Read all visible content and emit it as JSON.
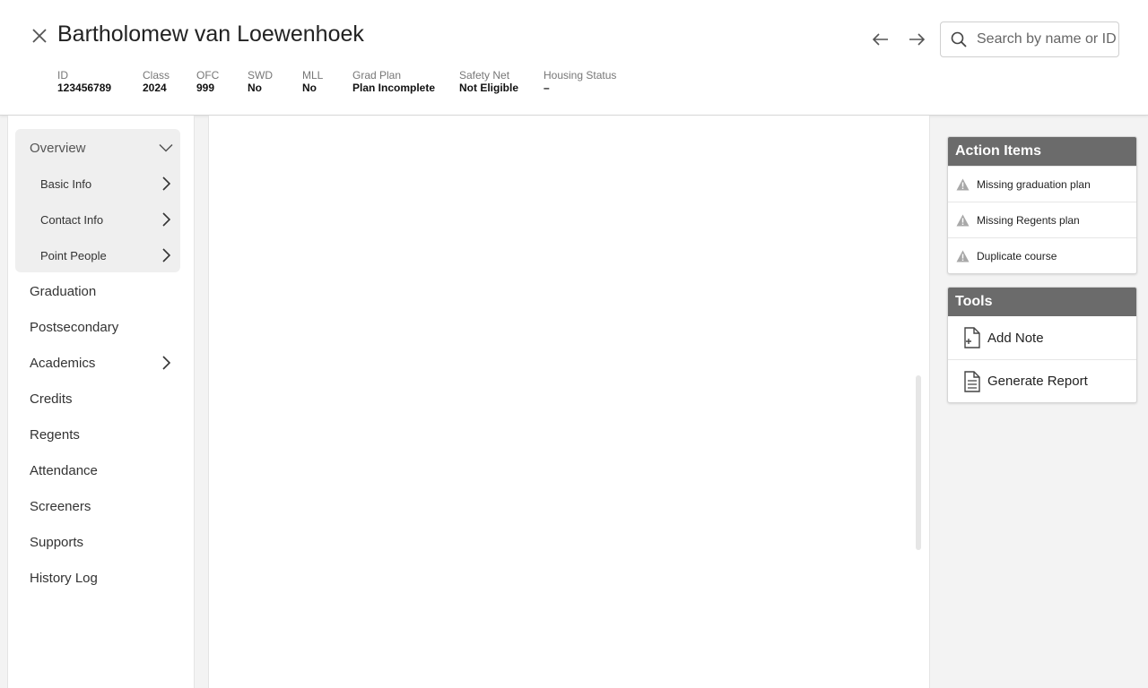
{
  "header": {
    "student_name": "Bartholomew van Loewenhoek",
    "search_placeholder": "Search by name or ID",
    "meta": [
      {
        "label": "ID",
        "value": "123456789"
      },
      {
        "label": "Class",
        "value": "2024"
      },
      {
        "label": "OFC",
        "value": "999"
      },
      {
        "label": "SWD",
        "value": "No"
      },
      {
        "label": "MLL",
        "value": "No"
      },
      {
        "label": "Grad Plan",
        "value": "Plan Incomplete"
      },
      {
        "label": "Safety Net",
        "value": "Not Eligible"
      },
      {
        "label": "Housing Status",
        "value": "–"
      }
    ]
  },
  "sidebar": {
    "overview": {
      "label": "Overview",
      "items": [
        {
          "label": "Basic Info"
        },
        {
          "label": "Contact Info"
        },
        {
          "label": "Point People"
        }
      ]
    },
    "items": [
      {
        "label": "Graduation"
      },
      {
        "label": "Postsecondary"
      },
      {
        "label": "Academics"
      },
      {
        "label": "Credits"
      },
      {
        "label": "Regents"
      },
      {
        "label": "Attendance"
      },
      {
        "label": "Screeners"
      },
      {
        "label": "Supports"
      },
      {
        "label": "History Log"
      }
    ]
  },
  "action_items": {
    "title": "Action Items",
    "items": [
      {
        "label": "Missing graduation plan",
        "icon": "warning-icon"
      },
      {
        "label": "Missing Regents plan",
        "icon": "warning-icon"
      },
      {
        "label": "Duplicate course",
        "icon": "warning-icon"
      }
    ]
  },
  "tools": {
    "title": "Tools",
    "items": [
      {
        "label": "Add Note",
        "icon": "add-note-icon"
      },
      {
        "label": "Generate Report",
        "icon": "report-icon"
      }
    ]
  },
  "colors": {
    "panel_header": "#6b6b6b",
    "overview_bg": "#efefef",
    "warning_icon": "#a8a8a8"
  }
}
